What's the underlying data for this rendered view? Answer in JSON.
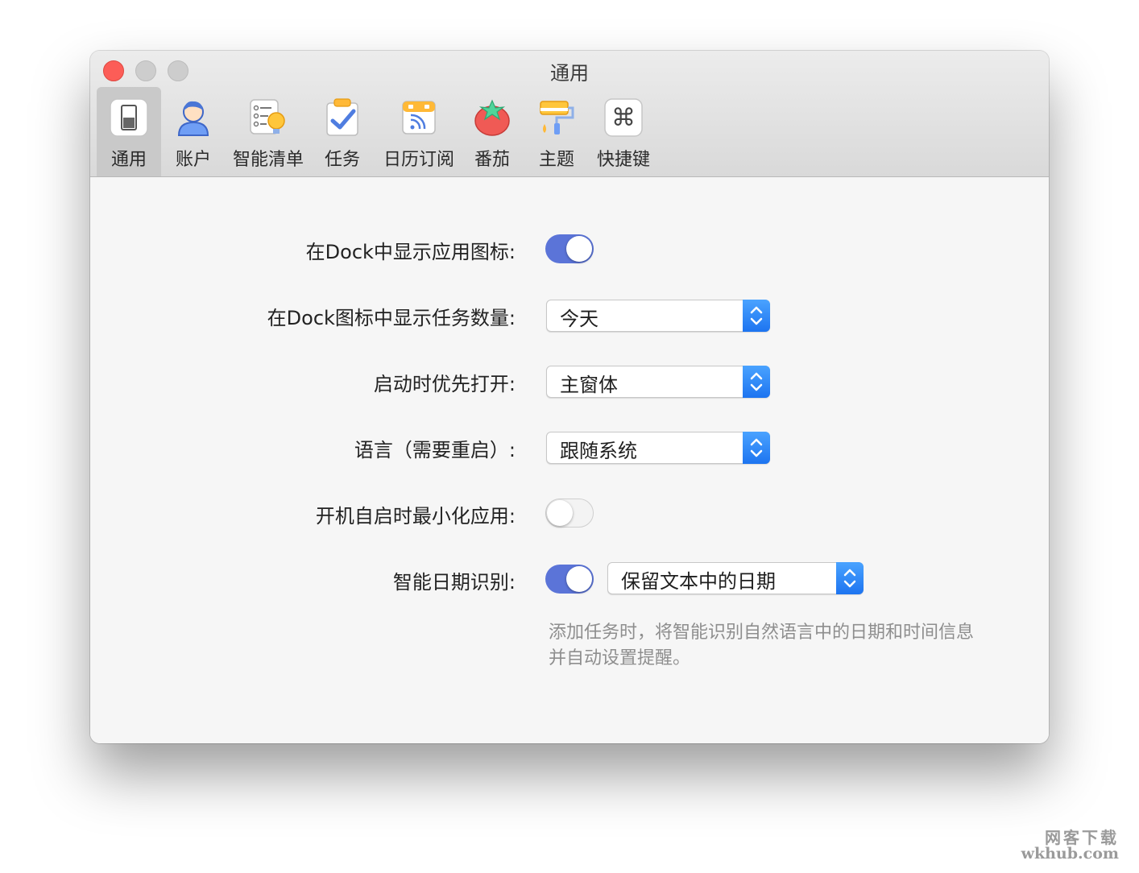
{
  "window": {
    "title": "通用"
  },
  "tabs": [
    {
      "label": "通用",
      "icon": "switch-icon",
      "active": true
    },
    {
      "label": "账户",
      "icon": "account-icon"
    },
    {
      "label": "智能清单",
      "icon": "smart-list-icon"
    },
    {
      "label": "任务",
      "icon": "task-icon"
    },
    {
      "label": "日历订阅",
      "icon": "calendar-subscribe-icon"
    },
    {
      "label": "番茄",
      "icon": "tomato-icon"
    },
    {
      "label": "主题",
      "icon": "theme-icon"
    },
    {
      "label": "快捷键",
      "icon": "shortcut-icon"
    }
  ],
  "settings": {
    "dock_icon": {
      "label": "在Dock中显示应用图标:",
      "enabled": true
    },
    "dock_badge": {
      "label": "在Dock图标中显示任务数量:",
      "value": "今天"
    },
    "startup_open": {
      "label": "启动时优先打开:",
      "value": "主窗体"
    },
    "language": {
      "label": "语言（需要重启）:",
      "value": "跟随系统"
    },
    "launch_minimized": {
      "label": "开机自启时最小化应用:",
      "enabled": false
    },
    "smart_date": {
      "label": "智能日期识别:",
      "enabled": true,
      "value": "保留文本中的日期",
      "hint": "添加任务时，将智能识别自然语言中的日期和时间信息并自动设置提醒。"
    }
  },
  "watermark": {
    "line1": "网客下载",
    "line2": "wkhub.com"
  },
  "colors": {
    "accent": "#5b74d8",
    "stepper": "#2b86f5",
    "close": "#fc5d57"
  }
}
